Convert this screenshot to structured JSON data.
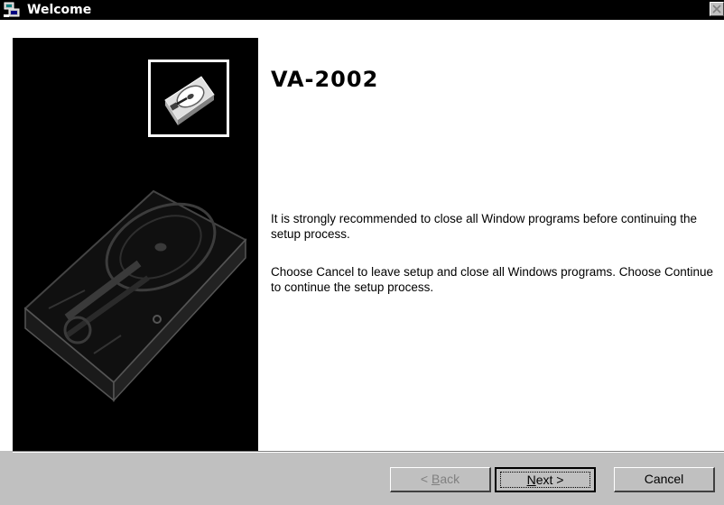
{
  "window": {
    "title": "Welcome",
    "icon": "setup-computer-icon",
    "close_icon": "close-x-icon"
  },
  "side_panel": {
    "small_image": "hard-drive-icon",
    "large_image": "hard-drive-illustration"
  },
  "main": {
    "product_title": "VA-2002",
    "message_1": "It is strongly recommended to close all Window programs before continuing the setup process.",
    "message_2": "Choose Cancel to leave setup and close all Windows programs. Choose Continue to continue the setup process."
  },
  "buttons": {
    "back_prefix": "< ",
    "back_accel": "B",
    "back_rest": "ack",
    "next_accel": "N",
    "next_rest": "ext >",
    "cancel": "Cancel",
    "back_enabled": false,
    "default": "next"
  },
  "colors": {
    "title_bar": "#000000",
    "panel_bg": "#000000",
    "dialog_face": "#c0c0c0",
    "content_bg": "#ffffff",
    "disabled_text": "#808080"
  }
}
